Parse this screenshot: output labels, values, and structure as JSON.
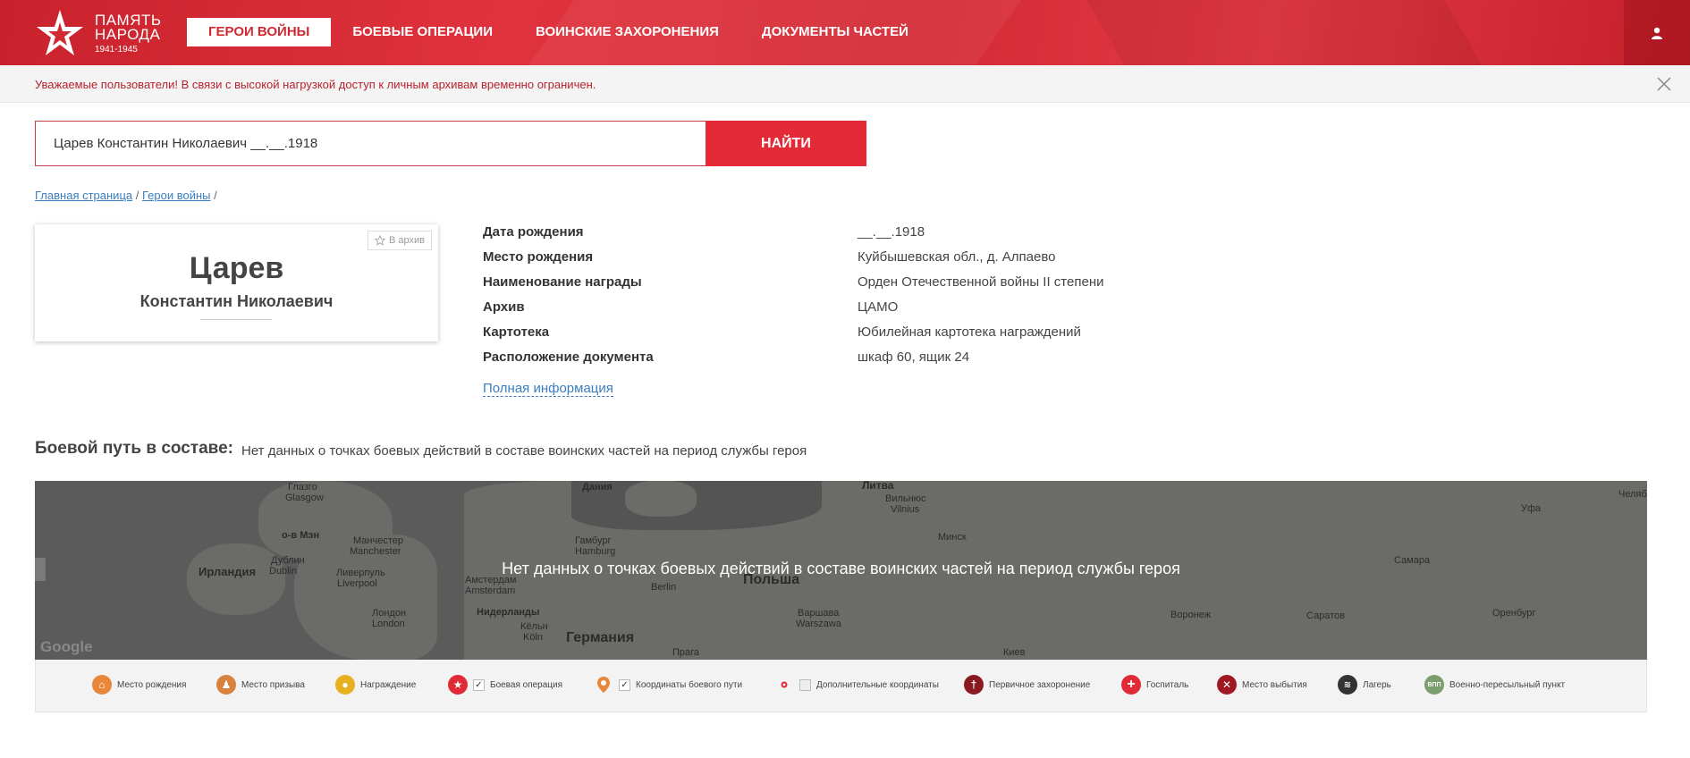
{
  "header": {
    "logo_line1": "ПАМЯТЬ",
    "logo_line2": "НАРОДА",
    "logo_years": "1941-1945",
    "nav": [
      {
        "label": "ГЕРОИ ВОЙНЫ",
        "active": true
      },
      {
        "label": "БОЕВЫЕ ОПЕРАЦИИ"
      },
      {
        "label": "ВОИНСКИЕ ЗАХОРОНЕНИЯ"
      },
      {
        "label": "ДОКУМЕНТЫ ЧАСТЕЙ"
      }
    ]
  },
  "notice": {
    "text": "Уважаемые пользователи! В связи с высокой нагрузкой доступ к личным архивам временно ограничен."
  },
  "search": {
    "value": "Царев Константин Николаевич __.__.1918",
    "button": "НАЙТИ"
  },
  "breadcrumb": {
    "home": "Главная страница",
    "sep1": "/",
    "heroes": "Герои войны",
    "sep2": "/"
  },
  "card": {
    "archive_label": "В архив",
    "surname": "Царев",
    "name": "Константин Николаевич"
  },
  "info": [
    {
      "label": "Дата рождения",
      "value": "__.__.1918"
    },
    {
      "label": "Место рождения",
      "value": "Куйбышевская обл., д. Алпаево"
    },
    {
      "label": "Наименование награды",
      "value": "Орден Отечественной войны II степени"
    },
    {
      "label": "Архив",
      "value": "ЦАМО"
    },
    {
      "label": "Картотека",
      "value": "Юбилейная картотека награждений"
    },
    {
      "label": "Расположение документа",
      "value": "шкаф 60, ящик 24"
    }
  ],
  "full_info_link": "Полная информация",
  "combat_path": {
    "title": "Боевой путь в составе:",
    "note": "Нет данных о точках боевых действий в составе воинских частей на период службы героя"
  },
  "map": {
    "overlay": "Нет данных о точках боевых действий в составе воинских частей на период службы героя",
    "google": "Google",
    "labels": {
      "glasgow_ru": "Глазго",
      "glasgow": "Glasgow",
      "isle_of_man": "о-в Мэн",
      "ireland": "Ирландия",
      "dublin_ru": "Дублин",
      "dublin": "Dublin",
      "manchester_ru": "Манчестер",
      "manchester": "Manchester",
      "liverpool_ru": "Ливерпуль",
      "liverpool": "Liverpool",
      "london_ru": "Лондон",
      "london": "London",
      "denmark": "Дания",
      "hamburg_ru": "Гамбург",
      "hamburg": "Hamburg",
      "amsterdam_ru": "Амстердам",
      "amsterdam": "Amsterdam",
      "netherlands": "Нидерланды",
      "cologne_ru": "Кёльн",
      "cologne": "Köln",
      "germany": "Германия",
      "berlin": "Berlin",
      "poland": "Польша",
      "warsaw_ru": "Варшава",
      "warsaw": "Warszawa",
      "prague": "Прага",
      "lithuania": "Литва",
      "vilnius_ru": "Вильнюс",
      "vilnius": "Vilnius",
      "minsk": "Минск",
      "kyiv": "Киев",
      "voronezh": "Воронеж",
      "saratov": "Саратов",
      "samara": "Самара",
      "orenburg": "Оренбург",
      "ufa": "Уфа",
      "chelyabinsk": "Челяб"
    }
  },
  "legend": [
    {
      "label": "Место рождения",
      "icon": "house-icon",
      "color": "#e8863a"
    },
    {
      "label": "Место призыва",
      "icon": "soldier-icon",
      "color": "#d9823f"
    },
    {
      "label": "Награждение",
      "icon": "medal-icon",
      "color": "#e6b020"
    },
    {
      "label": "Боевая операция",
      "icon": "star-icon",
      "color": "#e02a36",
      "checked": true
    },
    {
      "label": "Координаты боевого пути",
      "icon": "pin-icon",
      "color": "#e8863a",
      "checked": true
    },
    {
      "label": "Дополнительные координаты",
      "icon": "dot-icon",
      "color": "#e02a36",
      "checked": false
    },
    {
      "label": "Первичное захоронение",
      "icon": "cross-icon",
      "color": "#8a1a20"
    },
    {
      "label": "Госпиталь",
      "icon": "plus-icon",
      "color": "#e02a36"
    },
    {
      "label": "Место выбытия",
      "icon": "x-icon",
      "color": "#a01824"
    },
    {
      "label": "Лагерь",
      "icon": "barbed-wire-icon",
      "color": "#333333"
    },
    {
      "label": "Военно-пересыльный пункт",
      "icon": "vpp-icon",
      "color": "#7a9e6e",
      "glyph": "ВПП"
    }
  ]
}
